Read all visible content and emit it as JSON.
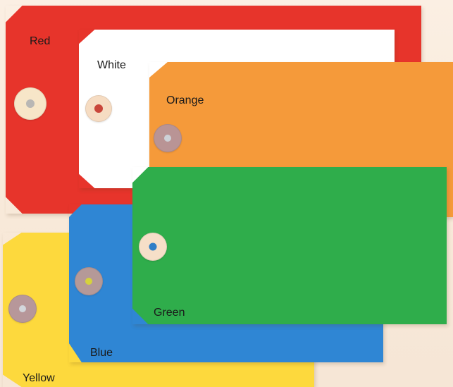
{
  "tags": [
    {
      "id": "red",
      "label": "Red",
      "color": "#e7342b",
      "grommet_color": "#f7e6c8",
      "hole_color": "#b9b7b4"
    },
    {
      "id": "white",
      "label": "White",
      "color": "#ffffff",
      "grommet_color": "#f6dcc2",
      "hole_color": "#c9463a"
    },
    {
      "id": "orange",
      "label": "Orange",
      "color": "#f59a3a",
      "grommet_color": "#b99495",
      "hole_color": "#cdd1d7"
    },
    {
      "id": "yellow",
      "label": "Yellow",
      "color": "#fdd93d",
      "grommet_color": "#b7979a",
      "hole_color": "#d3d6db"
    },
    {
      "id": "blue",
      "label": "Blue",
      "color": "#2f86d4",
      "grommet_color": "#b59998",
      "hole_color": "#d6d23c"
    },
    {
      "id": "green",
      "label": "Green",
      "color": "#2fad4b",
      "grommet_color": "#f6dfc8",
      "hole_color": "#2f7ec7"
    }
  ],
  "background": "#f8eadb"
}
